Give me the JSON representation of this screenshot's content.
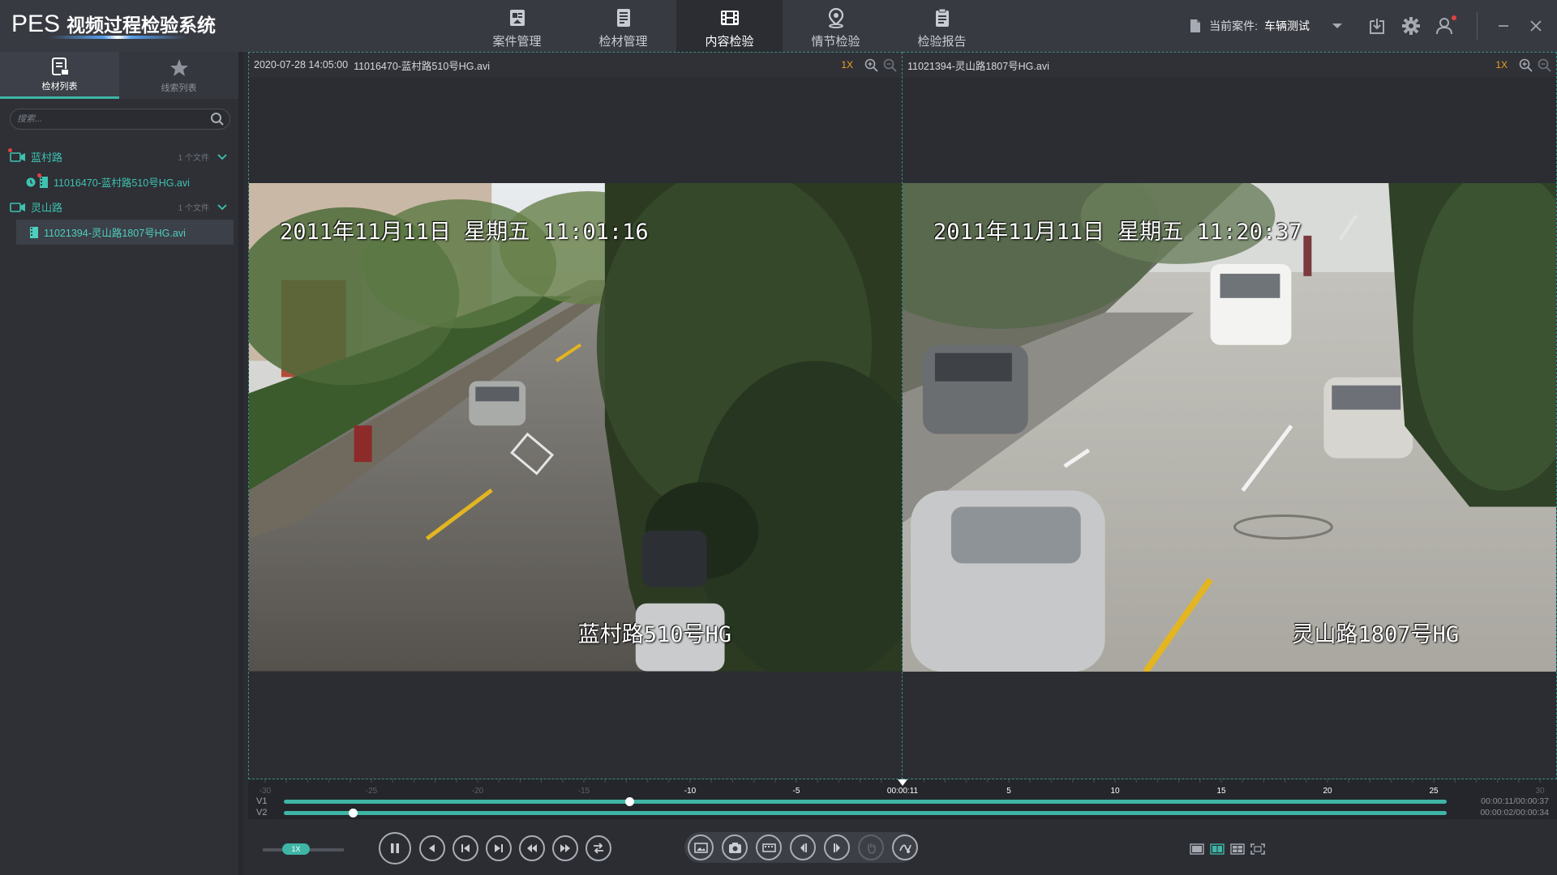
{
  "app": {
    "logo": "PES",
    "title": "视频过程检验系统"
  },
  "nav": {
    "items": [
      {
        "label": "案件管理",
        "icon": "case-icon"
      },
      {
        "label": "检材管理",
        "icon": "material-icon"
      },
      {
        "label": "内容检验",
        "icon": "film-icon",
        "active": true
      },
      {
        "label": "情节检验",
        "icon": "location-icon"
      },
      {
        "label": "检验报告",
        "icon": "report-icon"
      }
    ]
  },
  "header": {
    "case_label": "当前案件:",
    "case_value": "车辆测试"
  },
  "sidebar": {
    "tabs": [
      {
        "label": "检材列表",
        "active": true
      },
      {
        "label": "线索列表",
        "active": false
      }
    ],
    "search_placeholder": "搜索...",
    "groups": [
      {
        "name": "蓝村路",
        "count": "1 个文件",
        "files": [
          {
            "name": "11016470-蓝村路510号HG.avi",
            "selected": false
          }
        ]
      },
      {
        "name": "灵山路",
        "count": "1 个文件",
        "files": [
          {
            "name": "11021394-灵山路1807号HG.avi",
            "selected": true
          }
        ]
      }
    ]
  },
  "panes": {
    "left": {
      "datetime": "2020-07-28 14:05:00",
      "file": "11016470-蓝村路510号HG.avi",
      "zoom": "1X",
      "osd_time": "2011年11月11日 星期五 11:01:16",
      "osd_location": "蓝村路510号HG"
    },
    "right": {
      "file": "11021394-灵山路1807号HG.avi",
      "zoom": "1X",
      "osd_time": "2011年11月11日 星期五 11:20:37",
      "osd_location": "灵山路1807号HG"
    }
  },
  "timeline": {
    "ticks": [
      {
        "label": "-30",
        "dim": true
      },
      {
        "label": "-25",
        "dim": true
      },
      {
        "label": "-20",
        "dim": true
      },
      {
        "label": "-15",
        "dim": true
      },
      {
        "label": "-10",
        "dim": false
      },
      {
        "label": "-5",
        "dim": false
      },
      {
        "label": "00:00:11",
        "dim": false
      },
      {
        "label": "5",
        "dim": false
      },
      {
        "label": "10",
        "dim": false
      },
      {
        "label": "15",
        "dim": false
      },
      {
        "label": "20",
        "dim": false
      },
      {
        "label": "25",
        "dim": false
      },
      {
        "label": "30",
        "dim": true
      }
    ],
    "tracks": [
      {
        "name": "V1",
        "time": "00:00:11/00:00:37",
        "progress": 0.297
      },
      {
        "name": "V2",
        "time": "00:00:02/00:00:34",
        "progress": 0.059
      }
    ]
  },
  "controls": {
    "speed": "1X"
  },
  "colors": {
    "accent": "#3fb5a6",
    "zoom_label": "#f0a020",
    "header_bg": "#383a42",
    "panel_bg": "#2b2d33"
  }
}
